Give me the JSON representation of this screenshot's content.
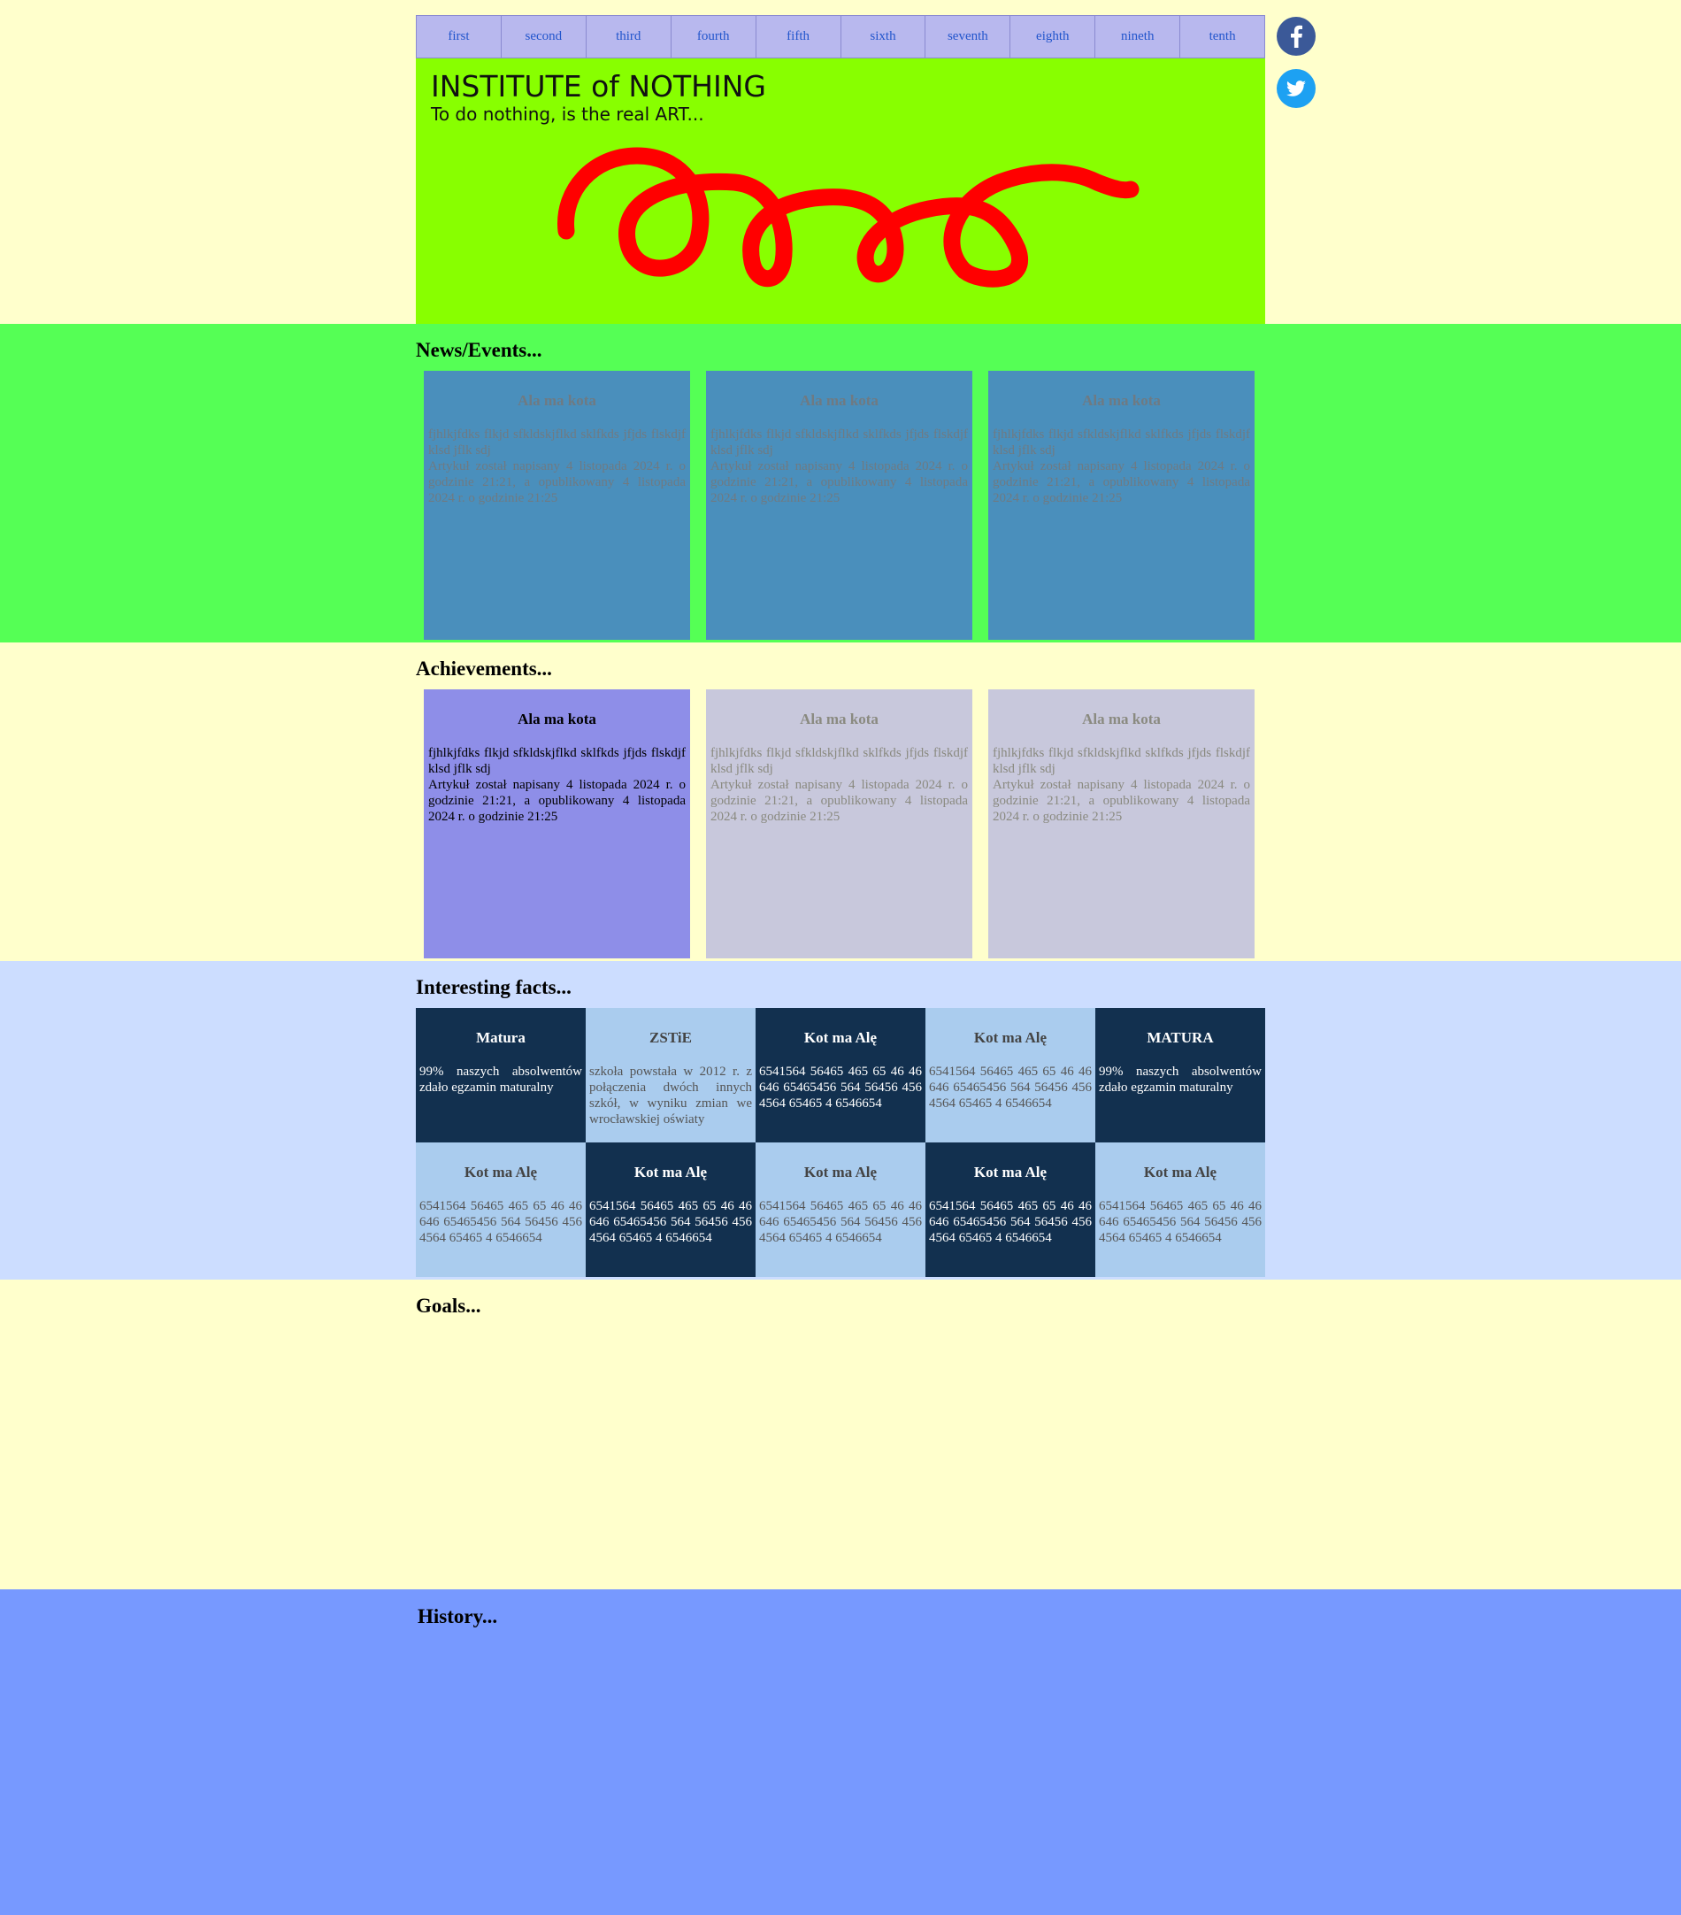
{
  "nav": {
    "items": [
      "first",
      "second",
      "third",
      "fourth",
      "fifth",
      "sixth",
      "seventh",
      "eighth",
      "nineth",
      "tenth"
    ]
  },
  "social": {
    "facebook_icon": "facebook-icon",
    "twitter_icon": "twitter-icon"
  },
  "header": {
    "title": "INSTITUTE of NOTHING",
    "subtitle": "To do nothing, is the real ART..."
  },
  "news": {
    "heading": "News/Events...",
    "cards": [
      {
        "title": "Ala ma kota",
        "body": "fjhlkjfdks flkjd sfkldskjflkd sklfkds jfjds flskdjf klsd jflk sdj",
        "meta": "Artykuł został napisany 4 listopada 2024 r. o godzinie 21:21, a opublikowany 4 listopada 2024 r. o godzinie 21:25"
      },
      {
        "title": "Ala ma kota",
        "body": "fjhlkjfdks flkjd sfkldskjflkd sklfkds jfjds flskdjf klsd jflk sdj",
        "meta": "Artykuł został napisany 4 listopada 2024 r. o godzinie 21:21, a opublikowany 4 listopada 2024 r. o godzinie 21:25"
      },
      {
        "title": "Ala ma kota",
        "body": "fjhlkjfdks flkjd sfkldskjflkd sklfkds jfjds flskdjf klsd jflk sdj",
        "meta": "Artykuł został napisany 4 listopada 2024 r. o godzinie 21:21, a opublikowany 4 listopada 2024 r. o godzinie 21:25"
      }
    ]
  },
  "achievements": {
    "heading": "Achievements...",
    "cards": [
      {
        "title": "Ala ma kota",
        "body": "fjhlkjfdks flkjd sfkldskjflkd sklfkds jfjds flskdjf klsd jflk sdj",
        "meta": "Artykuł został napisany 4 listopada 2024 r. o godzinie 21:21, a opublikowany 4 listopada 2024 r. o godzinie 21:25"
      },
      {
        "title": "Ala ma kota",
        "body": "fjhlkjfdks flkjd sfkldskjflkd sklfkds jfjds flskdjf klsd jflk sdj",
        "meta": "Artykuł został napisany 4 listopada 2024 r. o godzinie 21:21, a opublikowany 4 listopada 2024 r. o godzinie 21:25"
      },
      {
        "title": "Ala ma kota",
        "body": "fjhlkjfdks flkjd sfkldskjflkd sklfkds jfjds flskdjf klsd jflk sdj",
        "meta": "Artykuł został napisany 4 listopada 2024 r. o godzinie 21:21, a opublikowany 4 listopada 2024 r. o godzinie 21:25"
      }
    ]
  },
  "facts": {
    "heading": "Interesting facts...",
    "tiles": [
      {
        "title": "Matura",
        "body": "99% naszych absolwentów zdało egzamin maturalny"
      },
      {
        "title": "ZSTiE",
        "body": "szkoła powstała w 2012 r. z połączenia dwóch innych szkół, w wyniku zmian we wrocławskiej oświaty"
      },
      {
        "title": "Kot ma Alę",
        "body": "6541564 56465 465 65 46 46 646 65465456 564 56456 456 4564 65465 4 6546654"
      },
      {
        "title": "Kot ma Alę",
        "body": "6541564 56465 465 65 46 46 646 65465456 564 56456 456 4564 65465 4 6546654"
      },
      {
        "title": "MATURA",
        "body": "99% naszych absolwentów zdało egzamin maturalny"
      },
      {
        "title": "Kot ma Alę",
        "body": "6541564 56465 465 65 46 46 646 65465456 564 56456 456 4564 65465 4 6546654"
      },
      {
        "title": "Kot ma Alę",
        "body": "6541564 56465 465 65 46 46 646 65465456 564 56456 456 4564 65465 4 6546654"
      },
      {
        "title": "Kot ma Alę",
        "body": "6541564 56465 465 65 46 46 646 65465456 564 56456 456 4564 65465 4 6546654"
      },
      {
        "title": "Kot ma Alę",
        "body": "6541564 56465 465 65 46 46 646 65465456 564 56456 456 4564 65465 4 6546654"
      },
      {
        "title": "Kot ma Alę",
        "body": "6541564 56465 465 65 46 46 646 65465456 564 56456 456 4564 65465 4 6546654"
      }
    ]
  },
  "goals": {
    "heading": "Goals..."
  },
  "history": {
    "heading": "History..."
  },
  "colors": {
    "page_bg": "#ffffcc",
    "nav_bg": "#b8b8ee",
    "banner_bg": "#88ff00",
    "scribble": "#ff0000",
    "news_bg": "#55ff55",
    "news_card": "#4a8fbc",
    "ach_active": "#8e8ee8",
    "ach_card": "#c8c8dc",
    "facts_bg": "#ccddff",
    "fact_dark": "#12304f",
    "fact_light": "#aaccee",
    "history_bg": "#7799ff"
  }
}
